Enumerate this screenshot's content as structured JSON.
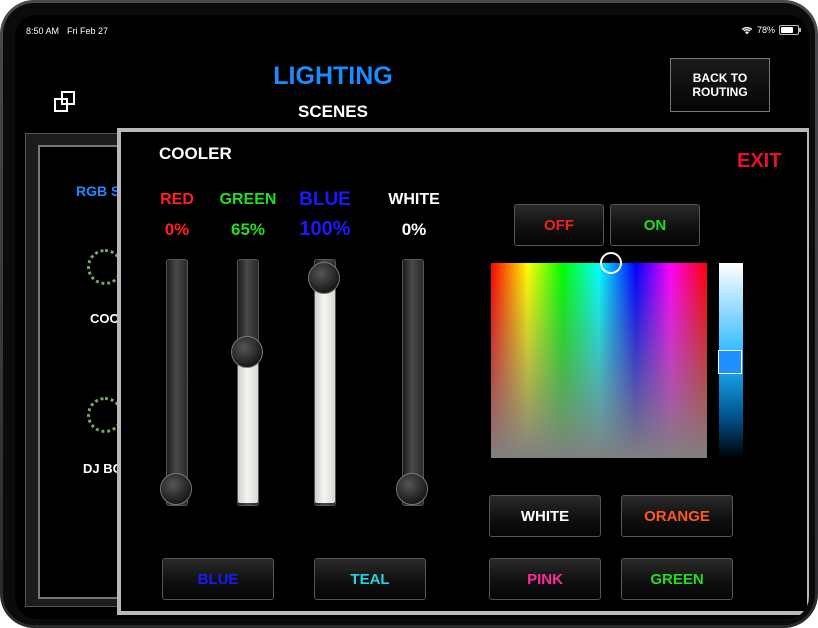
{
  "status_bar": {
    "time": "8:50 AM",
    "date": "Fri Feb 27",
    "battery": "78%"
  },
  "header": {
    "title": "LIGHTING",
    "subtitle": "SCENES",
    "back_button": "BACK TO ROUTING"
  },
  "background_panel": {
    "section_label": "RGB S",
    "items": [
      "COO",
      "DJ BO"
    ]
  },
  "dialog": {
    "title": "COOLER",
    "exit_label": "EXIT",
    "channels": [
      {
        "label": "RED",
        "value": "0%",
        "level": 0,
        "color": "#ff2020"
      },
      {
        "label": "GREEN",
        "value": "65%",
        "level": 0.65,
        "color": "#22dd22"
      },
      {
        "label": "BLUE",
        "value": "100%",
        "level": 1.0,
        "color": "#1a1aff"
      },
      {
        "label": "WHITE",
        "value": "0%",
        "level": 0,
        "color": "#ffffff"
      }
    ],
    "power": {
      "off_label": "OFF",
      "on_label": "ON",
      "off_color": "#ee2222",
      "on_color": "#22dd22"
    },
    "presets": [
      {
        "label": "WHITE",
        "color": "#ffffff"
      },
      {
        "label": "ORANGE",
        "color": "#ff5a1a"
      },
      {
        "label": "PINK",
        "color": "#ff2a9a"
      },
      {
        "label": "GREEN",
        "color": "#22dd22"
      },
      {
        "label": "BLUE",
        "color": "#1a1aff"
      },
      {
        "label": "TEAL",
        "color": "#2ad0e0"
      }
    ],
    "color_picker": {
      "brightness": "blue gradient"
    }
  }
}
